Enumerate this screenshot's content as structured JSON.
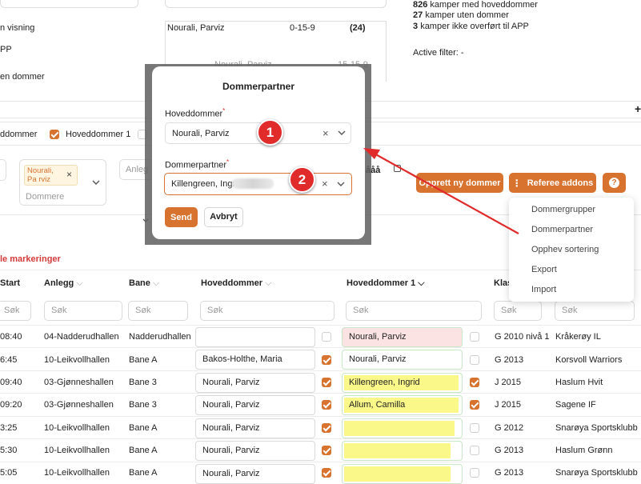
{
  "stats": {
    "line1_num": "826",
    "line1_text": "kamper med hoveddommer",
    "line2_num": "27",
    "line2_text": "kamper uten dommer",
    "line3_num": "3",
    "line3_text": "kamper ikke overført til APP",
    "active_filter": "Active filter: -"
  },
  "left_options": {
    "opt1": "n visning",
    "opt2": "PP",
    "opt3": "en dommer"
  },
  "mini_table": {
    "name": "Nourali, Parviz",
    "score": "0-15-9",
    "count": "(24)",
    "clipped_name": "Nourali, Parviz",
    "clipped_value": "15-15-9"
  },
  "filter_checks": {
    "label1": "ddommer",
    "label2": "Hoveddommer 1"
  },
  "filter_bar": {
    "tag": "Nourali, Pa rviz",
    "tag_close": "×",
    "dommere_placeholder": "Dommere",
    "anlegg_placeholder": "Anleg",
    "tomme_label": "ååå"
  },
  "buttons": {
    "opprett": "Opprett ny dommer",
    "referee_addons": "Referee addons",
    "help": "?"
  },
  "dropdown_menu": [
    "Dommergrupper",
    "Dommerpartner",
    "Opphev sortering",
    "Export",
    "Import"
  ],
  "reset_markings": "le markeringer",
  "modal": {
    "title": "Dommerpartner",
    "field1_label": "Hoveddommer",
    "field1_value": "Nourali, Parviz",
    "field2_label": "Dommerpartner",
    "field2_value": "Killengreen, Ingri",
    "required_mark": "*",
    "send": "Send",
    "cancel": "Avbryt"
  },
  "badges": [
    "1",
    "2"
  ],
  "table": {
    "columns": [
      "Start",
      "Anlegg",
      "Bane",
      "Hoveddommer",
      "Hoveddommer 1",
      "Klas",
      ""
    ],
    "search_placeholder": "Søk",
    "rows": [
      {
        "start": "08:40",
        "anlegg": "04-Nadderudhallen",
        "bane": "Nadderudhallen",
        "hoved": "",
        "hoved_checked": false,
        "hoved1": "Nourali, Parviz",
        "hoved1_checked": false,
        "klasse": "G 2010 nivå 1",
        "team": "Kråkerøy IL",
        "hl": "pink"
      },
      {
        "start": "6:45",
        "anlegg": "10-Leikvollhallen",
        "bane": "Bane A",
        "hoved": "Bakos-Holthe, Maria",
        "hoved_checked": true,
        "hoved1": "Nourali, Parviz",
        "hoved1_checked": false,
        "klasse": "G 2013",
        "team": "Korsvoll Warriors",
        "hl": "none"
      },
      {
        "start": "09:40",
        "anlegg": "03-Gjønneshallen",
        "bane": "Bane 3",
        "hoved": "Nourali, Parviz",
        "hoved_checked": true,
        "hoved1": "Killengreen, Ingrid",
        "hoved1_checked": true,
        "klasse": "J 2015",
        "team": "Haslum Hvit",
        "hl": "yellow"
      },
      {
        "start": "09:20",
        "anlegg": "03-Gjønneshallen",
        "bane": "Bane 3",
        "hoved": "Nourali, Parviz",
        "hoved_checked": true,
        "hoved1": "Allum, Camilla",
        "hoved1_checked": true,
        "klasse": "J 2015",
        "team": "Sagene IF",
        "hl": "yellow"
      },
      {
        "start": "3:25",
        "anlegg": "10-Leikvollhallen",
        "bane": "Bane A",
        "hoved": "Nourali, Parviz",
        "hoved_checked": true,
        "hoved1": "",
        "hoved1_checked": false,
        "klasse": "G 2012",
        "team": "Snarøya Sportsklubb",
        "hl": "yellow"
      },
      {
        "start": "5:30",
        "anlegg": "10-Leikvollhallen",
        "bane": "Bane A",
        "hoved": "Nourali, Parviz",
        "hoved_checked": true,
        "hoved1": "",
        "hoved1_checked": false,
        "klasse": "G 2013",
        "team": "Haslum Grønn",
        "hl": "yellow"
      },
      {
        "start": "5:05",
        "anlegg": "10-Leikvollhallen",
        "bane": "Bane A",
        "hoved": "Nourali, Parviz",
        "hoved_checked": true,
        "hoved1": "",
        "hoved1_checked": false,
        "klasse": "G 2013",
        "team": "Snarøya Sportsklubb",
        "hl": "yellow"
      }
    ]
  },
  "colors": {
    "accent": "#d7722f",
    "red": "#e12a2a",
    "highlight_yellow": "#fbf88a",
    "highlight_pink": "#fbe3e3"
  }
}
